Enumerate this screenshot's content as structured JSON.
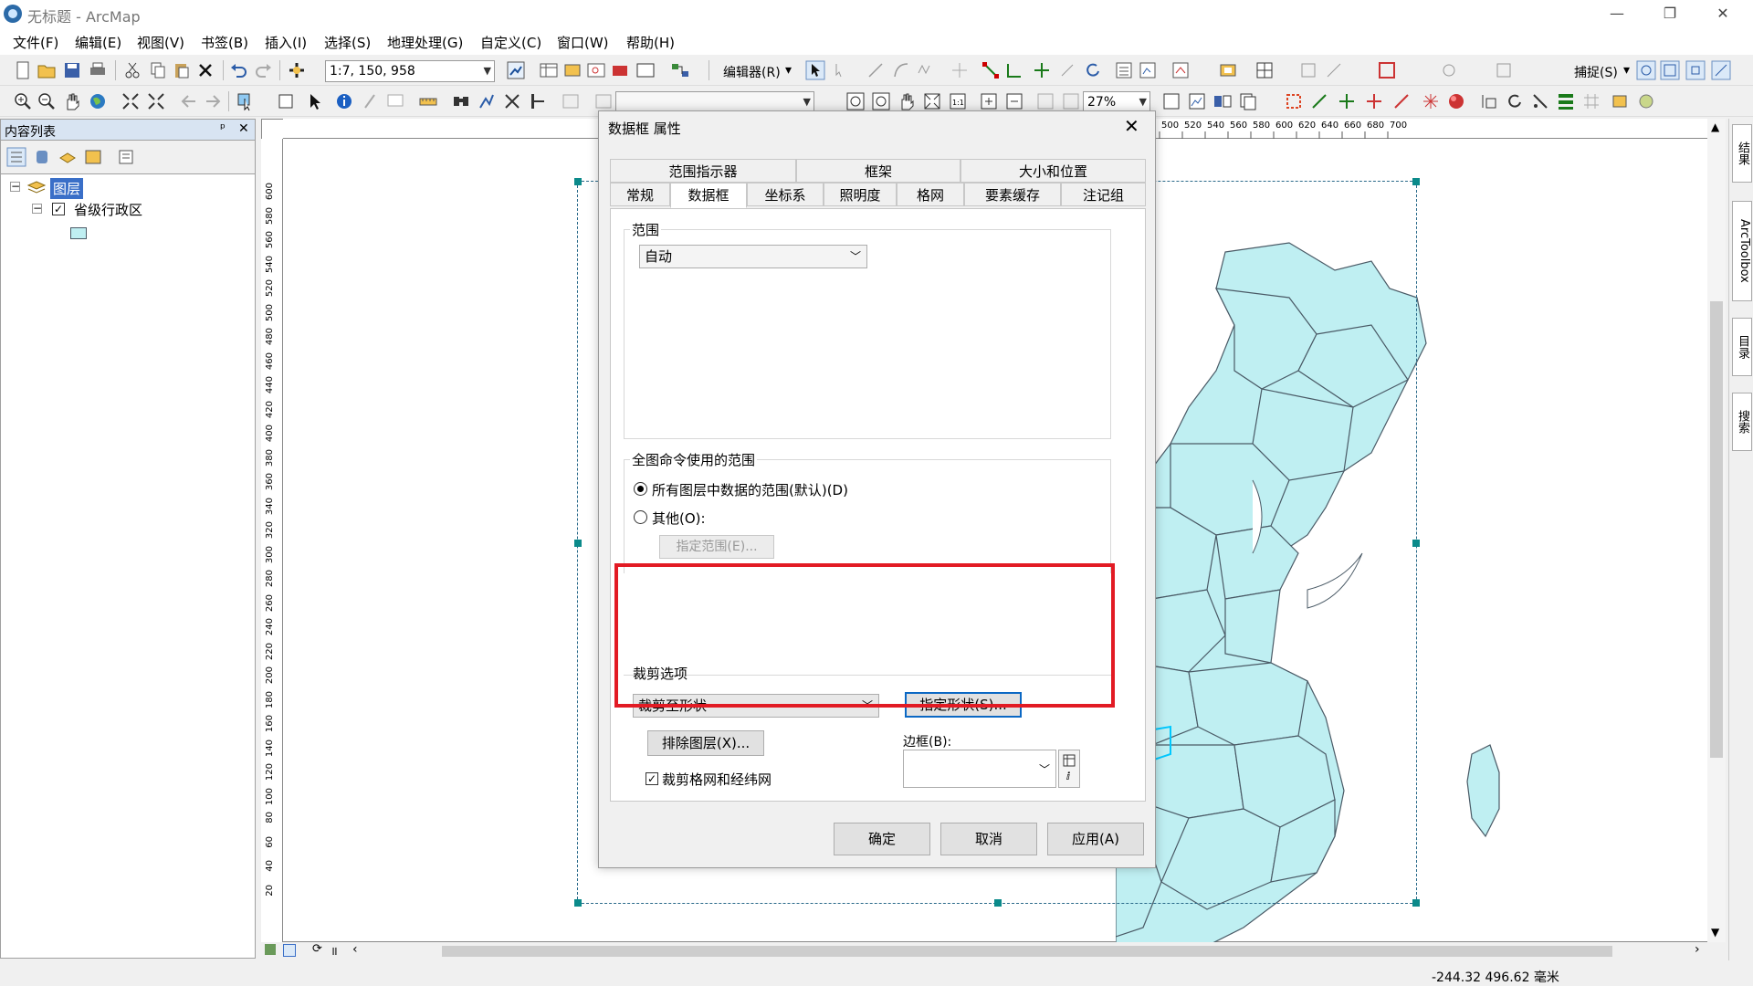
{
  "window": {
    "title": "无标题 - ArcMap",
    "min": "—",
    "restore": "❐",
    "close": "✕"
  },
  "menu": [
    "文件(F)",
    "编辑(E)",
    "视图(V)",
    "书签(B)",
    "插入(I)",
    "选择(S)",
    "地理处理(G)",
    "自定义(C)",
    "窗口(W)",
    "帮助(H)"
  ],
  "toolbar": {
    "scale": "1:7, 150, 958",
    "editor": "编辑器(R)",
    "snapping": "捕捉(S)",
    "zoom": "27%"
  },
  "toc": {
    "title": "内容列表",
    "pin": "ᵖ",
    "close": "✕",
    "layers_root": "图层",
    "layer_name": "省级行政区"
  },
  "rulers": {
    "h_ticks": [
      "500",
      "520",
      "540",
      "560",
      "580",
      "600",
      "620",
      "640",
      "660",
      "680",
      "700"
    ],
    "v_ticks": [
      "600",
      "580",
      "560",
      "540",
      "520",
      "500",
      "480",
      "460",
      "440",
      "420",
      "400",
      "380",
      "360",
      "340",
      "320",
      "300",
      "280",
      "260",
      "240",
      "220",
      "200",
      "180",
      "160",
      "140",
      "120",
      "100",
      "80",
      "60",
      "40",
      "20"
    ]
  },
  "dock": [
    "结果",
    "ArcToolbox",
    "目录",
    "搜索"
  ],
  "status": {
    "coords": "-244.32  496.62 毫米"
  },
  "dialog": {
    "title": "数据框 属性",
    "close": "✕",
    "tabs_top": [
      "范围指示器",
      "框架",
      "大小和位置"
    ],
    "tabs_bottom": [
      "常规",
      "数据框",
      "坐标系",
      "照明度",
      "格网",
      "要素缓存",
      "注记组"
    ],
    "extent": {
      "label": "范围",
      "value": "自动"
    },
    "full_extent": {
      "label": "全图命令使用的范围",
      "opt_all": "所有图层中数据的范围(默认)(D)",
      "opt_other": "其他(O):",
      "specify_btn": "指定范围(E)..."
    },
    "clip": {
      "label": "裁剪选项",
      "value": "裁剪至形状",
      "shape_btn": "指定形状(S)...",
      "exclude_btn": "排除图层(X)...",
      "border_label": "边框(B):",
      "clip_grid": "裁剪格网和经纬网"
    },
    "buttons": {
      "ok": "确定",
      "cancel": "取消",
      "apply": "应用(A)"
    }
  },
  "colors": {
    "accent": "#0b68c4",
    "highlight": "#e21b24",
    "map_fill": "#bfeff2",
    "map_stroke": "#4a5a66"
  }
}
